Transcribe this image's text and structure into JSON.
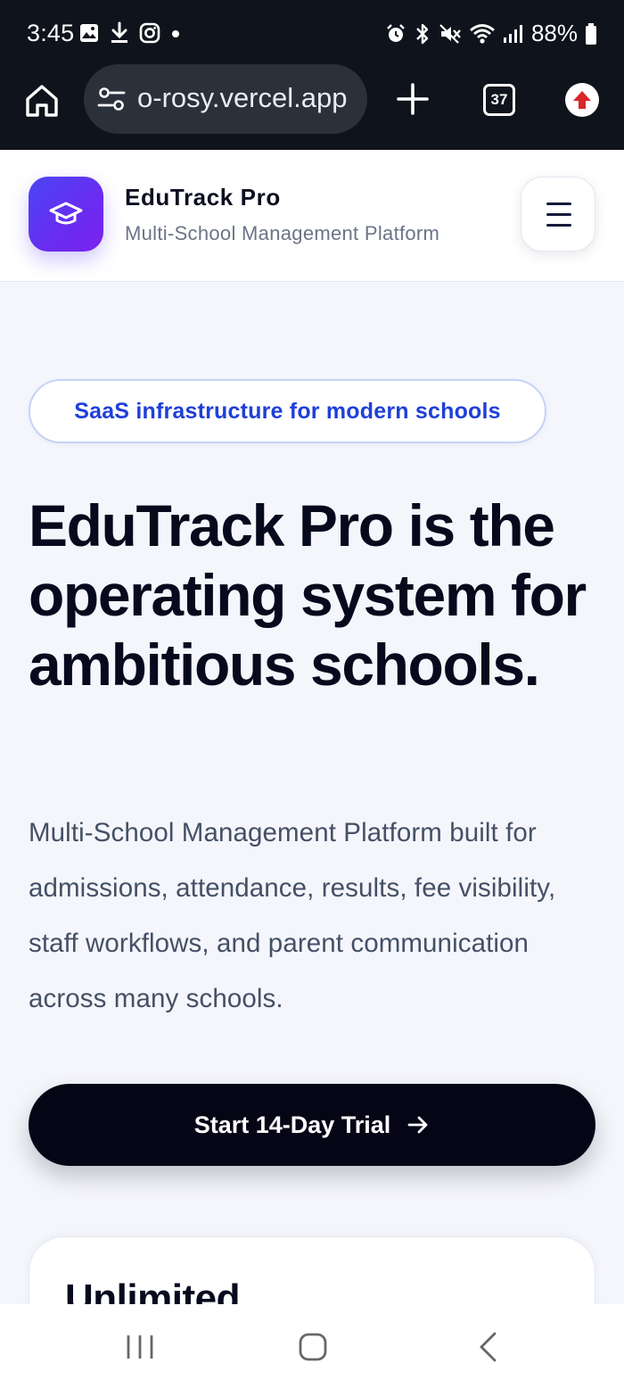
{
  "status_bar": {
    "time": "3:45",
    "battery": "88%",
    "left_icons": [
      "image-icon",
      "download-icon",
      "instagram-icon",
      "dot-icon"
    ],
    "right_icons": [
      "alarm-icon",
      "bluetooth-icon",
      "mute-icon",
      "wifi-icon",
      "signal-icon",
      "battery-icon"
    ]
  },
  "browser": {
    "url": "o-rosy.vercel.app",
    "tab_count": "37"
  },
  "header": {
    "brand_name": "EduTrack Pro",
    "brand_subtitle": "Multi-School Management Platform",
    "logo_icon": "graduation-cap-icon",
    "menu_icon": "hamburger-menu-icon"
  },
  "hero": {
    "tagline": "SaaS infrastructure for modern schools",
    "title": "EduTrack Pro is the operating system for ambitious schools.",
    "description": "Multi-School Management Platform built for admissions, attendance, results, fee visibility, staff workflows, and parent communication across many schools.",
    "cta_label": "Start 14-Day Trial",
    "cta_icon": "arrow-right-icon"
  },
  "card": {
    "title": "Unlimited"
  },
  "theme": {
    "accent": "#1f3fd8",
    "brand_gradient_start": "#4a46f5",
    "brand_gradient_end": "#7b22ef",
    "dark": "#050516"
  }
}
